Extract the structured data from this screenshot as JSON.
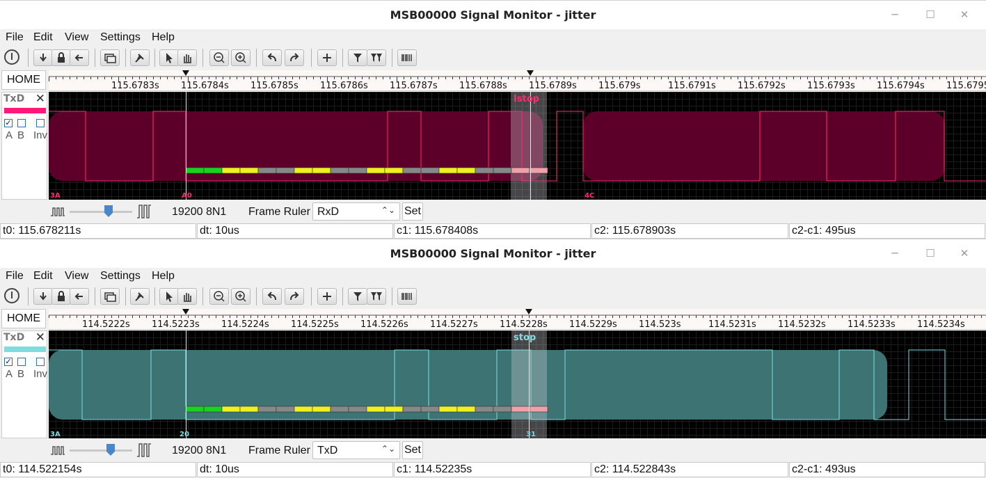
{
  "windows": [
    {
      "title": "MSB00000 Signal Monitor - jitter",
      "menu": [
        "File",
        "Edit",
        "View",
        "Settings",
        "Help"
      ],
      "home": "HOME",
      "ruler_labels": [
        "115.6783s",
        "115.6784s",
        "115.6785s",
        "115.6786s",
        "115.6787s",
        "115.6788s",
        "115.6789s",
        "115.679s",
        "115.6791s",
        "115.6792s",
        "115.6793s",
        "115.6794s",
        "115.6795"
      ],
      "channel": {
        "name": "TxD",
        "color": "#ff1a7a",
        "a_checked": true,
        "b_checked": false,
        "inv_checked": false,
        "labels": [
          "A",
          "B",
          "Inv"
        ]
      },
      "trace_color": "#ff2b6e",
      "fill_color": "#5c0029",
      "frame_labels": [
        "3A",
        "A0",
        "4C"
      ],
      "stop_label": "Istop",
      "baud": "19200 8N1",
      "frame_ruler_label": "Frame Ruler",
      "frame_ruler_value": "RxD",
      "set_label": "Set",
      "status": {
        "t0": "t0: 115.678211s",
        "dt": "dt: 10us",
        "c1": "c1: 115.678408s",
        "c2": "c2: 115.678903s",
        "diff": "c2-c1: 495us"
      }
    },
    {
      "title": "MSB00000 Signal Monitor - jitter",
      "menu": [
        "File",
        "Edit",
        "View",
        "Settings",
        "Help"
      ],
      "home": "HOME",
      "ruler_labels": [
        "114.5222s",
        "114.5223s",
        "114.5224s",
        "114.5225s",
        "114.5226s",
        "114.5227s",
        "114.5228s",
        "114.5229s",
        "114.523s",
        "114.5231s",
        "114.5232s",
        "114.5233s",
        "114.5234s"
      ],
      "channel": {
        "name": "TxD",
        "color": "#7fdde0",
        "a_checked": true,
        "b_checked": false,
        "inv_checked": false,
        "labels": [
          "A",
          "B",
          "Inv"
        ]
      },
      "trace_color": "#7fdde0",
      "fill_color": "#3e7373",
      "frame_labels": [
        "3A",
        "20",
        "31"
      ],
      "stop_label": "stop",
      "baud": "19200 8N1",
      "frame_ruler_label": "Frame Ruler",
      "frame_ruler_value": "TxD",
      "set_label": "Set",
      "status": {
        "t0": "t0: 114.522154s",
        "dt": "dt: 10us",
        "c1": "c1: 114.52235s",
        "c2": "c2: 114.522843s",
        "diff": "c2-c1: 493us"
      }
    }
  ]
}
